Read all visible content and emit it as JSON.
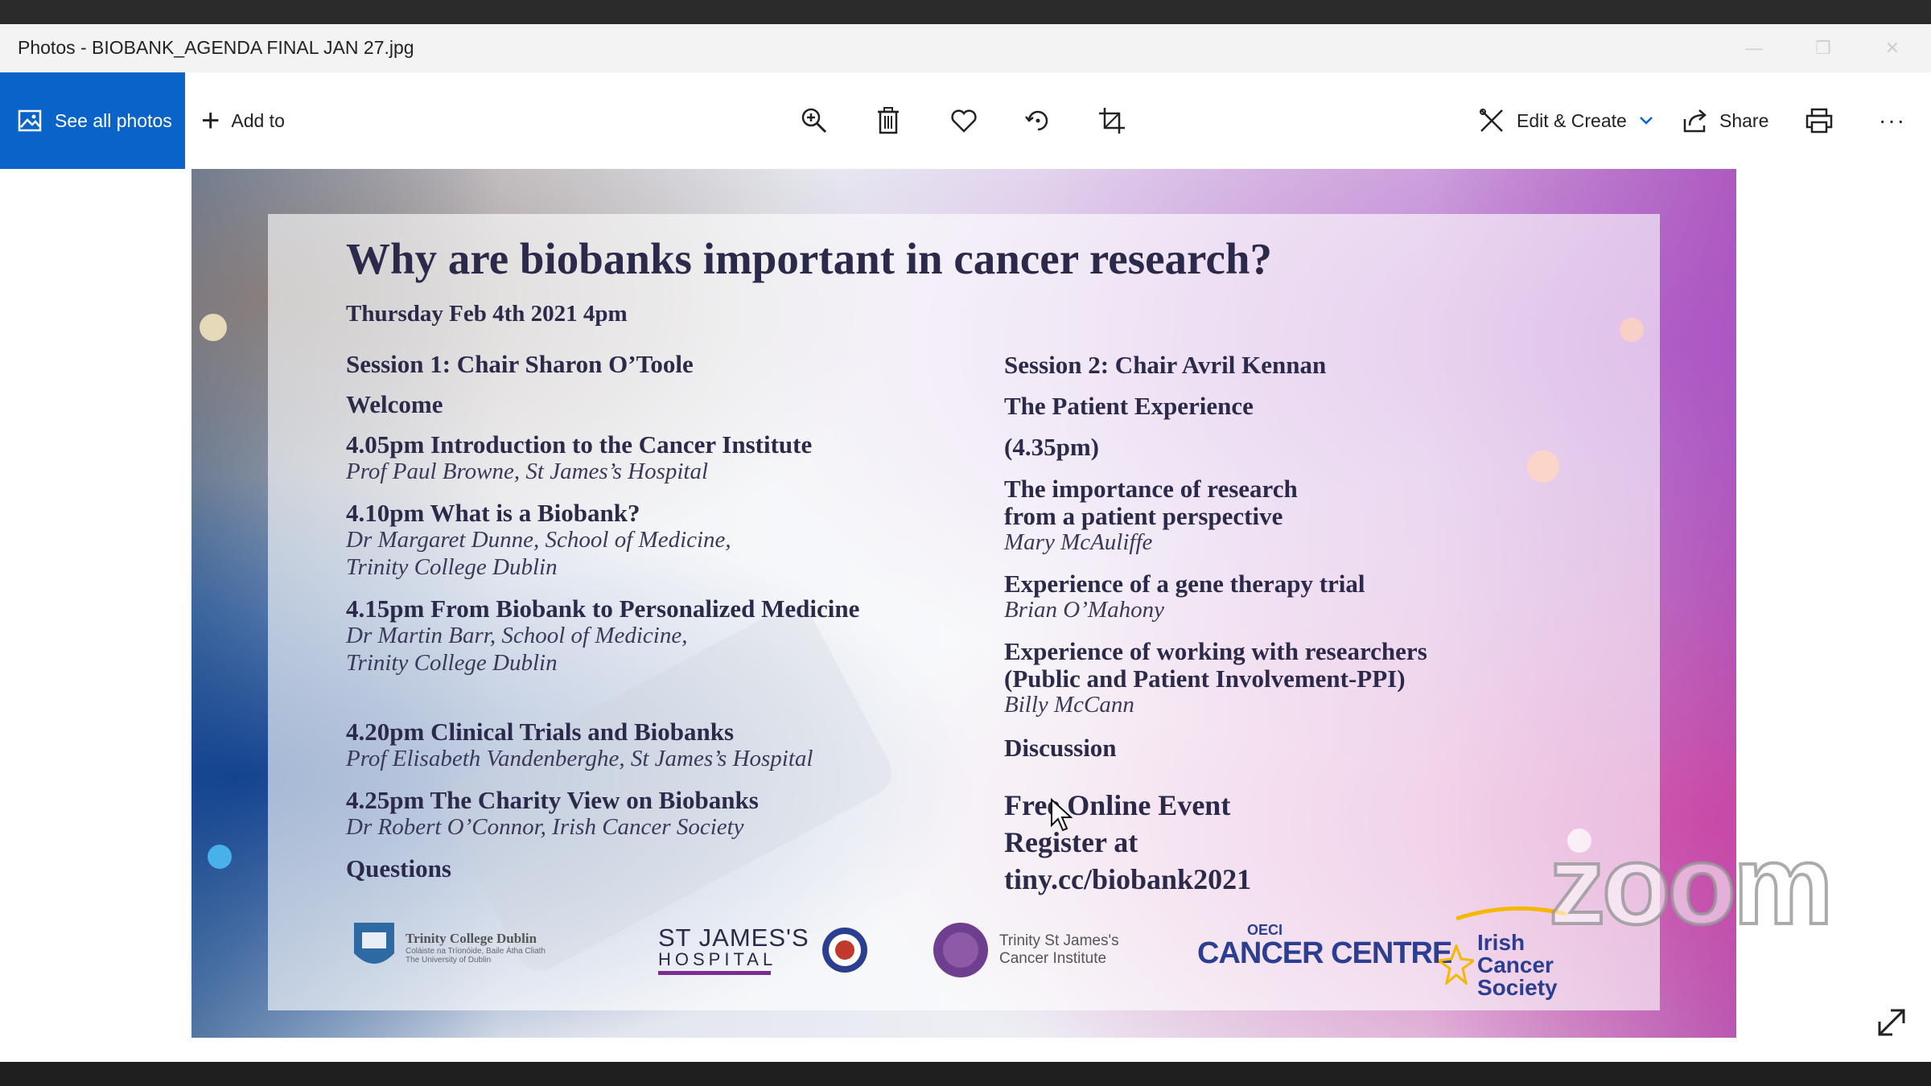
{
  "window": {
    "title": "Photos - BIOBANK_AGENDA FINAL JAN 27.jpg"
  },
  "toolbar": {
    "see_all_label": "See all photos",
    "add_to_label": "Add to",
    "edit_create_label": "Edit & Create",
    "share_label": "Share",
    "more_label": "···",
    "accent_color": "#0a63c9",
    "icons": [
      "zoom-in-icon",
      "delete-icon",
      "favorite-icon",
      "rotate-icon",
      "crop-icon",
      "edit-create-icon",
      "chevron-down-icon",
      "share-icon",
      "print-icon",
      "more-icon"
    ]
  },
  "slide": {
    "title": "Why are biobanks important in cancer research?",
    "date": "Thursday Feb 4th 2021 4pm",
    "session1": {
      "heading": "Session 1: Chair Sharon O’Toole",
      "welcome": "Welcome",
      "items": [
        {
          "title": "4.05pm Introduction to the Cancer Institute",
          "line1": "Prof Paul Browne, St James’s Hospital",
          "line2": ""
        },
        {
          "title": "4.10pm What is a Biobank?",
          "line1": "Dr Margaret Dunne, School of Medicine,",
          "line2": "Trinity College Dublin"
        },
        {
          "title": "4.15pm From Biobank to Personalized Medicine",
          "line1": "Dr Martin Barr, School of Medicine,",
          "line2": "Trinity College Dublin"
        },
        {
          "title": "4.20pm Clinical Trials and Biobanks",
          "line1": "Prof Elisabeth Vandenberghe, St James’s Hospital",
          "line2": ""
        },
        {
          "title": "4.25pm The Charity View on Biobanks",
          "line1": "Dr Robert O’Connor, Irish Cancer Society",
          "line2": ""
        }
      ],
      "questions": "Questions"
    },
    "session2": {
      "heading": "Session 2: Chair Avril Kennan",
      "subheading": "The Patient Experience",
      "time": "(4.35pm)",
      "talk1_line1": "The importance of research",
      "talk1_line2": "from a patient perspective",
      "talk1_speaker": "Mary McAuliffe",
      "talk2_title": "Experience of a gene therapy trial",
      "talk2_speaker": "Brian O’Mahony",
      "talk3_line1": "Experience of working with researchers",
      "talk3_line2": "(Public and Patient Involvement-PPI)",
      "talk3_speaker": "Billy McCann",
      "discussion": "Discussion",
      "event_line1": "Free Online Event",
      "event_line2": "Register at",
      "event_line3": "tiny.cc/biobank2021"
    },
    "logos": {
      "tcd_line1": "Trinity College Dublin",
      "tcd_line2": "Coláiste na Tríonóide, Baile Átha Cliath",
      "tcd_line3": "The University of Dublin",
      "sjh_line1": "ST JAMES'S",
      "sjh_line2": "HOSPITAL",
      "tsci_line1": "Trinity St James's",
      "tsci_line2": "Cancer Institute",
      "oeci_small": "OECI",
      "oeci_big": "CANCER CENTRE",
      "ics_line1": "Irish",
      "ics_line2": "Cancer",
      "ics_line3": "Society"
    }
  },
  "overlay": {
    "zoom_watermark": "zoom"
  }
}
